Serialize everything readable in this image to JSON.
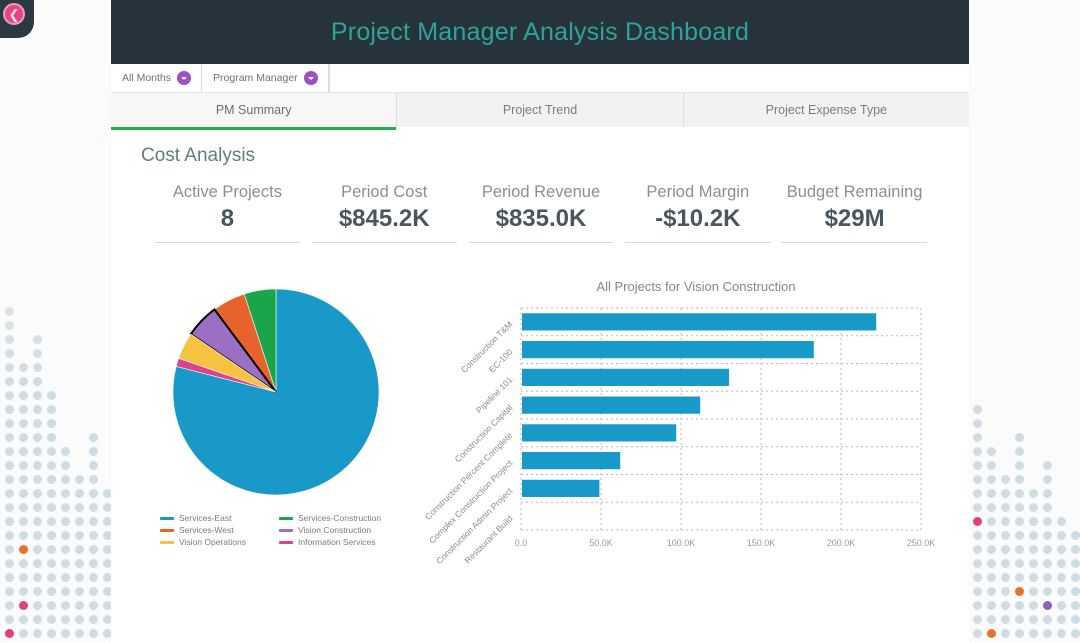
{
  "back_tab": {
    "icon": "back-arrow-icon",
    "color": "#e8447f"
  },
  "header": {
    "title": "Project Manager Analysis Dashboard",
    "bg": "#26333b",
    "title_color": "#2fa39b"
  },
  "filters": [
    {
      "label": "All Months",
      "caret": "chevron-down-icon"
    },
    {
      "label": "Program Manager",
      "caret": "chevron-down-icon"
    }
  ],
  "tabs": [
    {
      "label": "PM Summary",
      "active": true
    },
    {
      "label": "Project Trend",
      "active": false
    },
    {
      "label": "Project Expense Type",
      "active": false
    }
  ],
  "section": {
    "title": "Cost Analysis"
  },
  "kpis": [
    {
      "label": "Active Projects",
      "value": "8"
    },
    {
      "label": "Period Cost",
      "value": "$845.2K"
    },
    {
      "label": "Period Revenue",
      "value": "$835.0K"
    },
    {
      "label": "Period Margin",
      "value": "-$10.2K"
    },
    {
      "label": "Budget Remaining",
      "value": "$29M"
    }
  ],
  "chart_data": [
    {
      "type": "pie",
      "title": "",
      "legend_position": "bottom",
      "categories": [
        "Services-East",
        "Services-Construction",
        "Services-West",
        "Vision Construction",
        "Vision Operations",
        "Information Services"
      ],
      "values": [
        79.0,
        5.0,
        5.2,
        5.3,
        4.2,
        1.3
      ],
      "colors": [
        "#1899c8",
        "#1ba54b",
        "#e8622b",
        "#9b6fc4",
        "#f5c242",
        "#e0418b"
      ],
      "selected_slice": "Vision Construction",
      "selected_outline": "#000000"
    },
    {
      "type": "bar",
      "orientation": "horizontal",
      "title": "All Projects for Vision Construction",
      "categories": [
        "Construction T&M",
        "EC-100",
        "Pipeline 101",
        "Construction Capital",
        "Construction Percent Complete",
        "Complex Construction Project",
        "Construction Admin Project",
        "Restaurant Build"
      ],
      "values": [
        222000,
        183000,
        130000,
        112000,
        97000,
        62000,
        49000,
        0
      ],
      "bar_color": "#1899c8",
      "xlabel": "",
      "ylabel": "",
      "xlim": [
        0,
        250000
      ],
      "xticks": [
        0,
        50000,
        100000,
        150000,
        200000,
        250000
      ],
      "xtick_labels": [
        "0.0",
        "50.0K",
        "100.0K",
        "150.0K",
        "200.0K",
        "250.0K"
      ],
      "grid": true
    }
  ]
}
